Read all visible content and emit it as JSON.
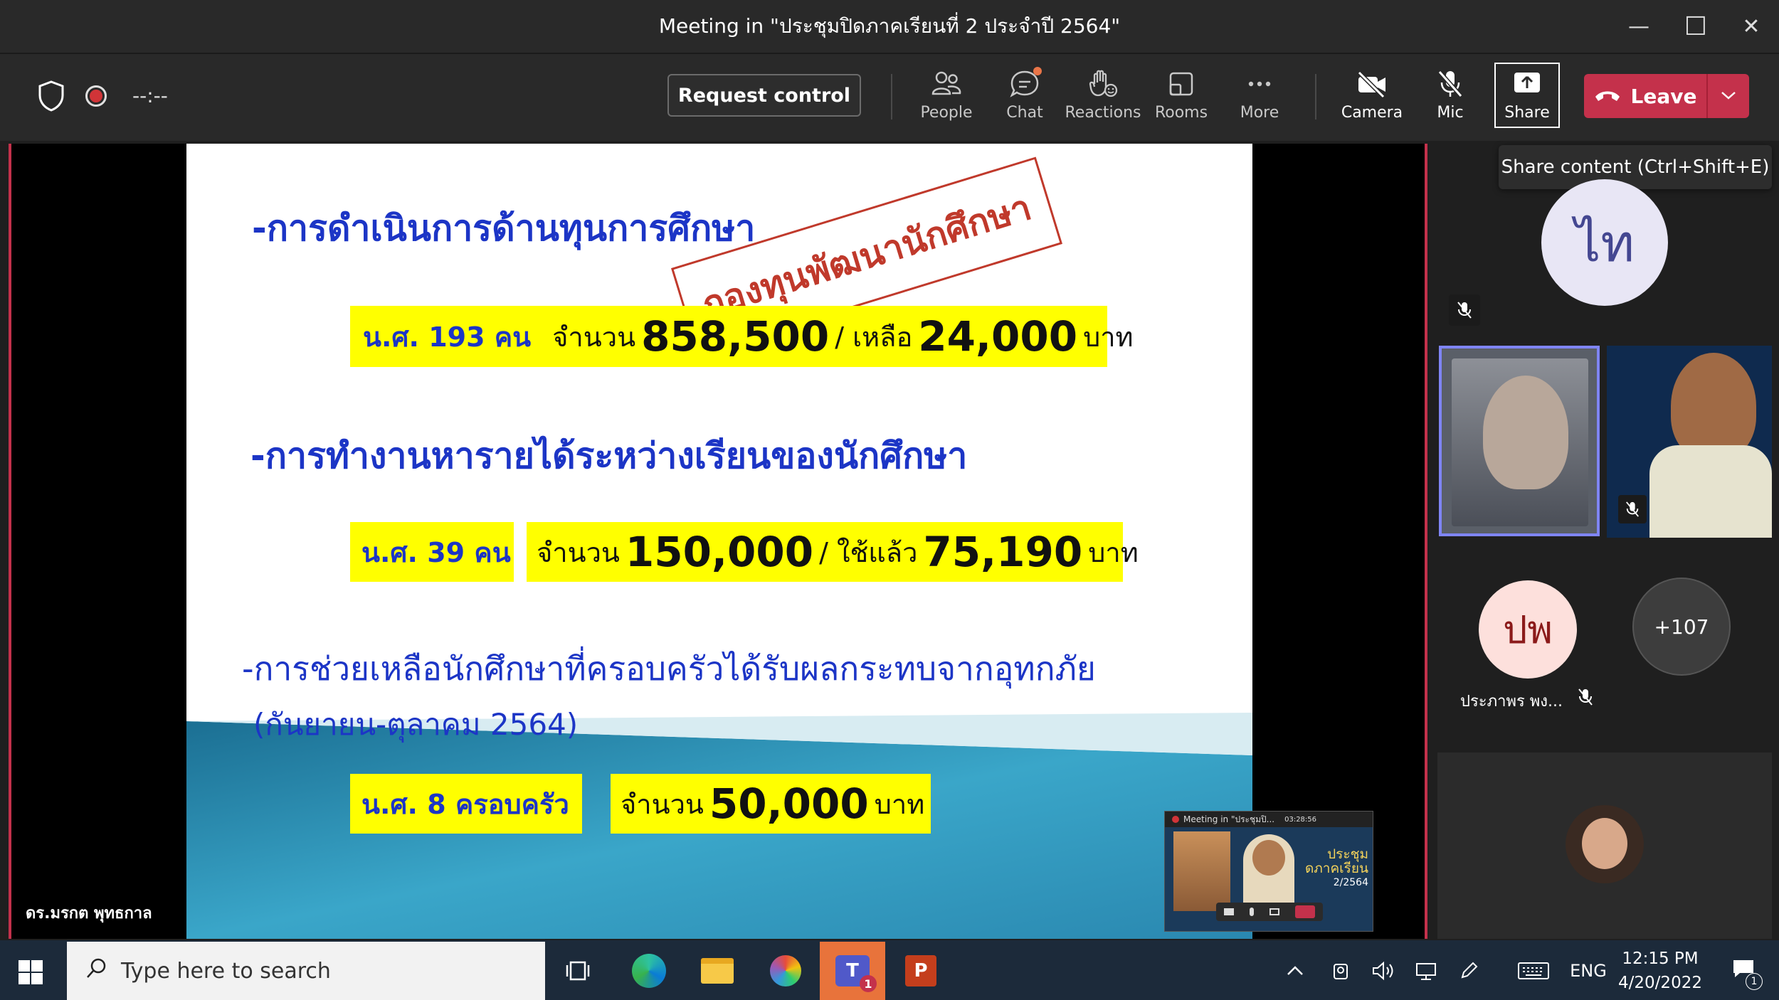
{
  "window": {
    "title": "Meeting in \"ประชุมปิดภาคเรียนที่ 2 ประจำปี 2564\"",
    "minimize": "—",
    "maximize": "☐",
    "close": "✕"
  },
  "toolbar": {
    "timer": "--:--",
    "request_control": "Request control",
    "people": "People",
    "chat": "Chat",
    "reactions": "Reactions",
    "rooms": "Rooms",
    "more": "More",
    "camera": "Camera",
    "mic": "Mic",
    "share": "Share",
    "leave": "Leave",
    "share_tooltip": "Share content (Ctrl+Shift+E)"
  },
  "slide": {
    "heading1": "-การดำเนินการด้านทุนการศึกษา",
    "stamp": "กองทุนพัฒนานักศึกษา",
    "row1": {
      "a": "น.ศ. 193 คน",
      "b": "จำนวน",
      "c": "858,500",
      "d": "/ เหลือ",
      "e": "24,000",
      "f": "บาท"
    },
    "heading2": "-การทำงานหารายได้ระหว่างเรียนของนักศึกษา",
    "row2": {
      "a": "น.ศ. 39 คน",
      "b": "จำนวน",
      "c": "150,000",
      "d": "/ ใช้แล้ว",
      "e": "75,190",
      "f": "บาท"
    },
    "heading3": "-การช่วยเหลือนักศึกษาที่ครอบครัวได้รับผลกระทบจากอุทกภัย",
    "heading3b": "(กันยายน-ตุลาคม 2564)",
    "row3": {
      "a": "น.ศ. 8 ครอบครัว",
      "b": "จำนวน",
      "c": "50,000",
      "f": "บาท"
    }
  },
  "presenter": {
    "name": "ดร.มรกต พุทธกาล"
  },
  "pip": {
    "title": "Meeting in \"ประชุมปิ...",
    "time": "03:28:56",
    "line1": "ประชุม",
    "line2": "ดภาคเรียน",
    "line3": "2/2564"
  },
  "participants": {
    "avatar1": "ไท",
    "avatar2": "ปพ",
    "avatar2_name": "ประภาพร พง...",
    "overflow": "+107"
  },
  "taskbar": {
    "search_placeholder": "Type here to search",
    "teams_badge": "1",
    "lang": "ENG",
    "time": "12:15 PM",
    "date": "4/20/2022",
    "notif": "1"
  },
  "colors": {
    "accent_red": "#c4314b",
    "slide_blue": "#1c35c6",
    "highlight": "#ffff00",
    "stamp": "#c0392b",
    "avatar1_bg": "#e8e6f5",
    "avatar2_bg": "#fde0dc"
  }
}
